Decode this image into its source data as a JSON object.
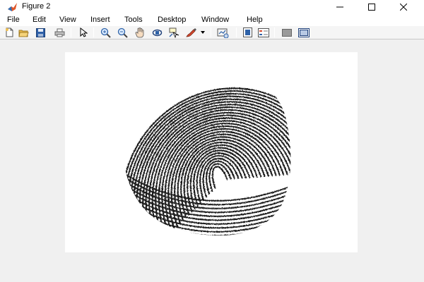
{
  "window": {
    "title": "Figure 2"
  },
  "menu": {
    "items": [
      "File",
      "Edit",
      "View",
      "Insert",
      "Tools",
      "Desktop",
      "Window",
      "Help"
    ]
  },
  "toolbar": {
    "buttons": [
      {
        "name": "new-figure-icon"
      },
      {
        "name": "open-file-icon"
      },
      {
        "name": "save-figure-icon"
      },
      {
        "name": "print-figure-icon"
      },
      {
        "name": "edit-plot-arrow-icon"
      },
      {
        "name": "zoom-in-icon"
      },
      {
        "name": "zoom-out-icon"
      },
      {
        "name": "pan-hand-icon"
      },
      {
        "name": "rotate-3d-icon"
      },
      {
        "name": "data-cursor-icon"
      },
      {
        "name": "brush-data-icon"
      },
      {
        "name": "link-plot-icon"
      },
      {
        "name": "insert-colorbar-icon"
      },
      {
        "name": "insert-legend-icon"
      },
      {
        "name": "hide-plot-tools-icon"
      },
      {
        "name": "show-plot-tools-icon"
      }
    ]
  },
  "figure": {
    "content": "fingerprint-image"
  },
  "colors": {
    "titlebar": "#ffffff",
    "background": "#f0f0f0",
    "image_background": "#ffffff",
    "ridges": "#1a1a1a"
  }
}
